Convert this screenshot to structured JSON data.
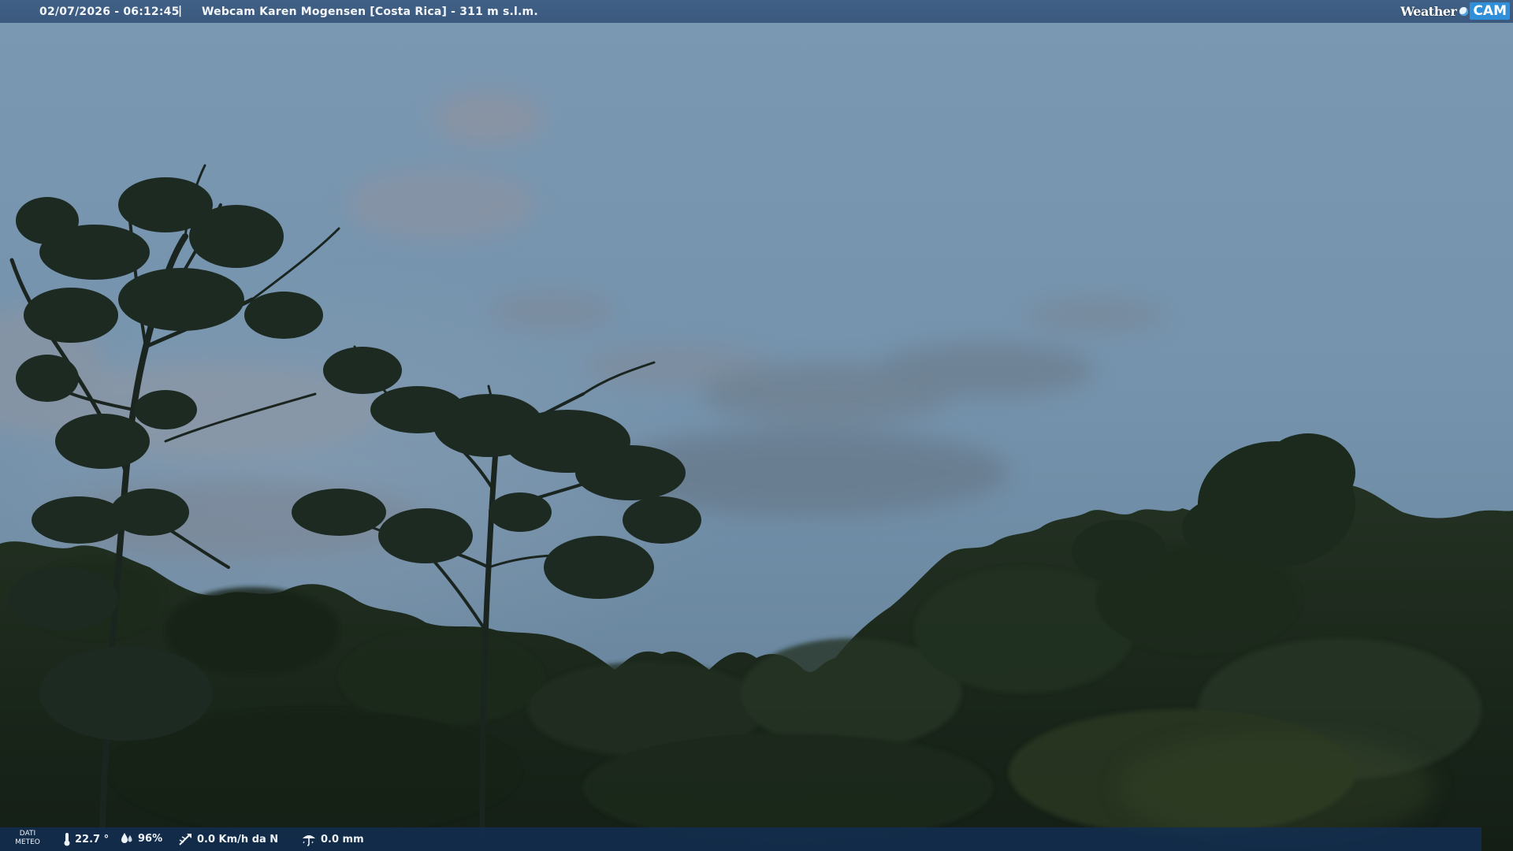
{
  "overlay": {
    "datetime": "02/07/2026 - 06:12:45",
    "separator": "|",
    "title": "Webcam Karen Mogensen [Costa Rica]  - 311 m s.l.m.",
    "logo": {
      "weather": "Weather",
      "cam": "CAM"
    }
  },
  "weather_bar": {
    "label_line1": "DATI",
    "label_line2": "METEO",
    "temperature": "22.7 °",
    "humidity": "96%",
    "wind": "0.0 Km/h da N",
    "rain": "0.0 mm"
  },
  "colors": {
    "sky_top": "#7f9cb6",
    "sky_bottom": "#5f7c95",
    "forest": "#1c2a1c",
    "bar_top": "#3c5c82",
    "bar_bottom": "#122e50",
    "logo_accent": "#2f8fd8"
  }
}
